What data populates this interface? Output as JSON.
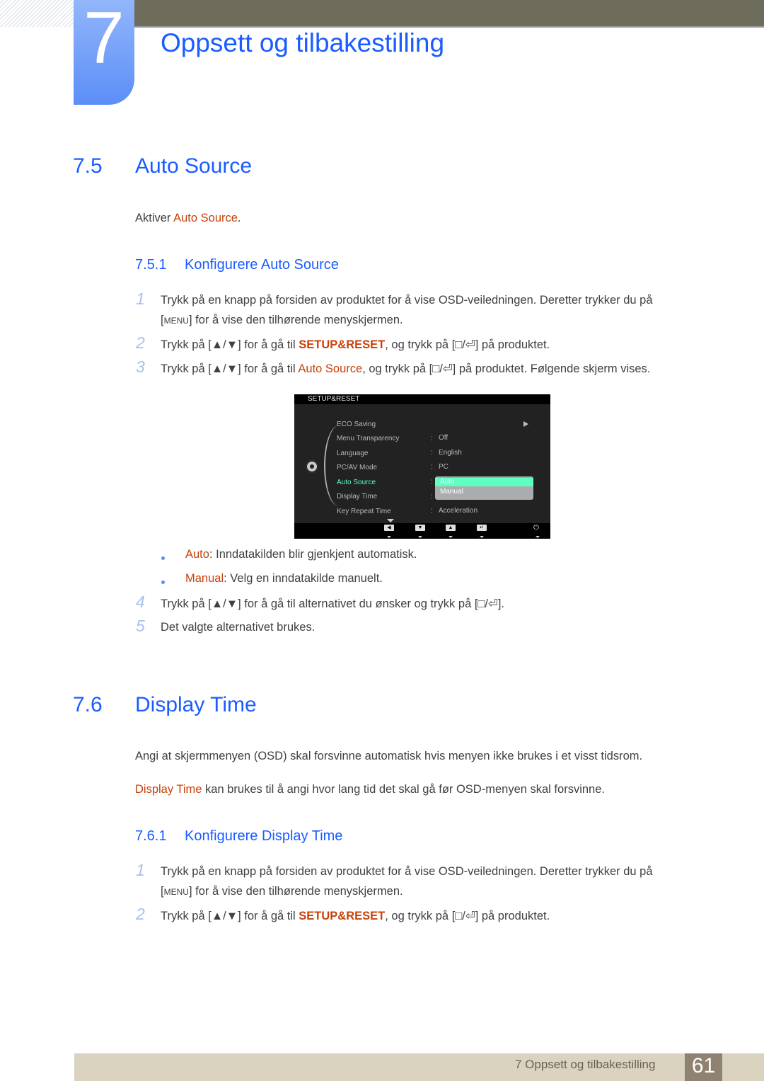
{
  "chapter": {
    "number": "7",
    "title": "Oppsett og tilbakestilling"
  },
  "section_7_5": {
    "number": "7.5",
    "title": "Auto Source",
    "intro_prefix": "Aktiver ",
    "intro_highlight": "Auto Source",
    "intro_suffix": ".",
    "subsection": {
      "number": "7.5.1",
      "title": "Konfigurere Auto Source"
    },
    "steps": [
      {
        "num": "1",
        "line1": "Trykk på en knapp på forsiden av produktet for å vise OSD-veiledningen. Deretter trykker du på",
        "line2_key": "MENU",
        "line2_rest": " for å vise den tilhørende menyskjermen."
      },
      {
        "num": "2",
        "prefix": "Trykk på ",
        "key1": "▲/▼",
        "mid": " for å gå til ",
        "highlight": "SETUP&RESET",
        "mid2": ", og trykk på ",
        "key2": "□/⏎",
        "suffix": " på produktet."
      },
      {
        "num": "3",
        "prefix": "Trykk på ",
        "key1": "▲/▼",
        "mid": " for å gå til ",
        "highlight": "Auto Source",
        "mid2": ", og trykk på ",
        "key2": "□/⏎",
        "suffix": " på produktet. Følgende skjerm vises."
      },
      {
        "num": "4",
        "prefix": "Trykk på ",
        "key1": "▲/▼",
        "mid": " for å gå til alternativet du ønsker og trykk på ",
        "key2": "□/⏎",
        "suffix": "."
      },
      {
        "num": "5",
        "text": "Det valgte alternativet brukes."
      }
    ],
    "options": [
      {
        "label": "Auto",
        "desc": ": Inndatakilden blir gjenkjent automatisk."
      },
      {
        "label": "Manual",
        "desc": ": Velg en inndatakilde manuelt."
      }
    ]
  },
  "osd": {
    "header": "SETUP&RESET",
    "items": [
      {
        "label": "ECO Saving",
        "value": ""
      },
      {
        "label": "Menu Transparency",
        "value": "Off"
      },
      {
        "label": "Language",
        "value": "English"
      },
      {
        "label": "PC/AV Mode",
        "value": "PC"
      },
      {
        "label": "Auto Source",
        "value": ""
      },
      {
        "label": "Display Time",
        "value": ""
      },
      {
        "label": "Key Repeat Time",
        "value": "Acceleration"
      }
    ],
    "colon": ":",
    "dropdown": {
      "selected": "Auto",
      "other": "Manual"
    },
    "buttons": [
      "◀",
      "▼",
      "▲",
      "↵"
    ],
    "power": "⏻"
  },
  "section_7_6": {
    "number": "7.6",
    "title": "Display Time",
    "para1": "Angi at skjermmenyen (OSD) skal forsvinne automatisk hvis menyen ikke brukes i et visst tidsrom.",
    "para2_highlight": "Display Time",
    "para2_rest": " kan brukes til å angi hvor lang tid det skal gå før OSD-menyen skal forsvinne.",
    "subsection": {
      "number": "7.6.1",
      "title": "Konfigurere Display Time"
    },
    "steps": [
      {
        "num": "1",
        "line1": "Trykk på en knapp på forsiden av produktet for å vise OSD-veiledningen. Deretter trykker du på",
        "line2_key": "MENU",
        "line2_rest": " for å vise den tilhørende menyskjermen."
      },
      {
        "num": "2",
        "prefix": "Trykk på ",
        "key1": "▲/▼",
        "mid": " for å gå til ",
        "highlight": "SETUP&RESET",
        "mid2": ", og trykk på ",
        "key2": "□/⏎",
        "suffix": " på produktet."
      }
    ]
  },
  "footer": {
    "chapter_label": "7 Oppsett og tilbakestilling",
    "page_number": "61"
  }
}
